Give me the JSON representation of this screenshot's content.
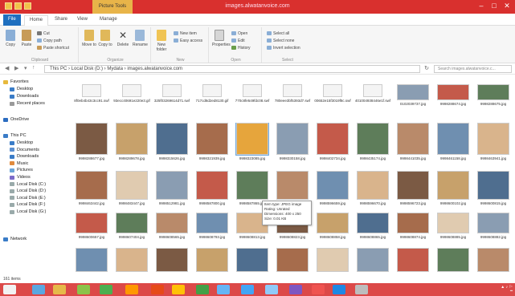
{
  "window": {
    "title": "images.alwatanvoice.com",
    "context_tab": "Picture Tools"
  },
  "tabs": [
    "File",
    "Home",
    "Share",
    "View",
    "Manage"
  ],
  "ribbon": {
    "clipboard": {
      "group": "Clipboard",
      "copy": "Copy",
      "paste": "Paste",
      "cut": "Cut",
      "copy_path": "Copy path",
      "paste_shortcut": "Paste shortcut"
    },
    "organize": {
      "group": "Organize",
      "move_to": "Move to",
      "copy_to": "Copy to",
      "delete": "Delete",
      "rename": "Rename"
    },
    "new": {
      "group": "New",
      "new_folder": "New folder",
      "new_item": "New item",
      "easy_access": "Easy access"
    },
    "open": {
      "group": "Open",
      "properties": "Properties",
      "open": "Open",
      "edit": "Edit",
      "history": "History"
    },
    "select": {
      "group": "Select",
      "select_all": "Select all",
      "select_none": "Select none",
      "invert": "Invert selection"
    }
  },
  "address": {
    "path": "This PC › Local Disk (D:) › Mydata › images.alwatanvoice.com",
    "search_placeholder": "Search images.alwatanvoice.c..."
  },
  "nav": {
    "favorites": "Favorites",
    "desktop": "Desktop",
    "downloads": "Downloads",
    "recent": "Recent places",
    "onedrive": "OneDrive",
    "thispc": "This PC",
    "pc_items": [
      "Desktop",
      "Documents",
      "Downloads",
      "Music",
      "Pictures",
      "Videos",
      "Local Disk (C:)",
      "Local Disk (D:)",
      "Local Disk (E:)",
      "Local Disk (F:)",
      "Local Disk (G:)"
    ],
    "network": "Network"
  },
  "rows": [
    [
      "8f0eb4b43c3cc91.swf",
      "93ecc40691e220e3.gif",
      "325f03269614d71.swf",
      "717cd8d2ed8130.gif",
      "770c8fe549fdc08.swf",
      "780eee3bf5393d7.swf",
      "00652e15f3019f8c.swf",
      "401004938446e1f.swf",
      "0102039737.jpg",
      "9998288674.jpg",
      "9998288675.jpg"
    ],
    [
      "9998288677.jpg",
      "9998289678.jpg",
      "9998315626.jpg",
      "9998321939.jpg",
      "9998323085.jpg",
      "9998330158.jpg",
      "9998402734.jpg",
      "9998435174.jpg",
      "9998441035.jpg",
      "9998461158.jpg",
      "9998463941.jpg"
    ],
    [
      "9998463442.jpg",
      "9998483447.jpg",
      "9998512981.jpg",
      "9998587800.jpg",
      "9998587865.jpg",
      "9998591794.jpg",
      "9998596659.jpg",
      "9998596670.jpg",
      "9998596723.jpg",
      "9998600102.jpg",
      "9998600815.jpg"
    ],
    [
      "9998600657.jpg",
      "9998607404.jpg",
      "9998608565.jpg",
      "9998608793.jpg",
      "9998608813.jpg",
      "9998608823.jpg",
      "9998608858.jpg",
      "9998608865.jpg",
      "9998608874.jpg",
      "9998608885.jpg",
      "9998608882.jpg"
    ],
    [
      "",
      "",
      "",
      "",
      "",
      "",
      "",
      "",
      "",
      "",
      ""
    ]
  ],
  "tooltip": {
    "type": "Item type: JPEG image",
    "rating": "Rating: Unrated",
    "dims": "Dimensions: 400 x 250",
    "size": "Size: 0.01 KB"
  },
  "status": {
    "count": "161 items"
  },
  "colors": {
    "titlebar": "#d9302e",
    "taskbar": "#dc4948",
    "accent": "#1e6fbf"
  }
}
